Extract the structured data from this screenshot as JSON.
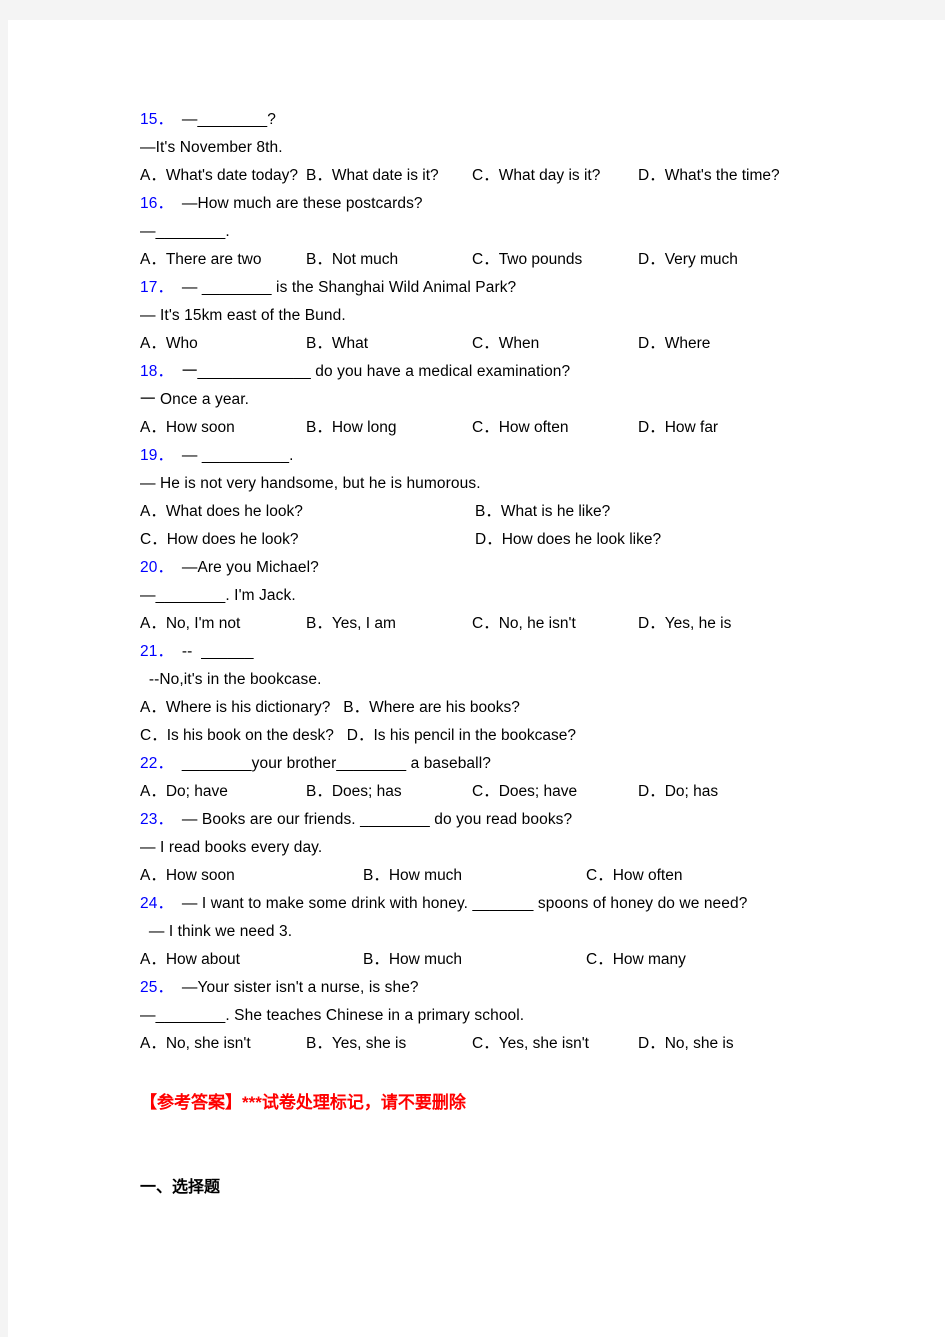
{
  "document": {
    "questions": [
      {
        "number": "15．",
        "lines": [
          "—________?",
          "—It's November 8th."
        ],
        "layout": "cols4",
        "options": [
          "A．What's date today?",
          "B．What date is it?",
          "C．What day is it?",
          "D．What's the time?"
        ]
      },
      {
        "number": "16．",
        "lines": [
          "—How much are these postcards?",
          "—________."
        ],
        "layout": "cols4",
        "options": [
          "A．There are two",
          "B．Not much",
          "C．Two pounds",
          "D．Very much"
        ]
      },
      {
        "number": "17．",
        "lines": [
          "— ________ is the Shanghai Wild Animal Park?",
          "— It's 15km east of the Bund."
        ],
        "layout": "cols4",
        "options": [
          "A．Who",
          "B．What",
          "C．When",
          "D．Where"
        ]
      },
      {
        "number": "18．",
        "lines": [
          "一_____________ do you have a medical examination?",
          "一 Once a year."
        ],
        "layout": "cols4",
        "options": [
          "A．How soon",
          "B．How long",
          "C．How often",
          "D．How far"
        ]
      },
      {
        "number": "19．",
        "lines": [
          "— __________.",
          "— He is not very handsome, but he is humorous."
        ],
        "layout": "cols2",
        "options": [
          "A．What does he look?",
          "B．What is he like?",
          "C．How does he look?",
          "D．How does he look like?"
        ]
      },
      {
        "number": "20．",
        "lines": [
          "—Are you Michael?",
          "—________. I'm Jack."
        ],
        "layout": "cols4",
        "options": [
          "A．No, I'm not",
          "B．Yes, I am",
          "C．No, he isn't",
          "D．Yes, he is"
        ]
      },
      {
        "number": "21．",
        "lines": [
          "--  ______",
          "  --No,it's in the bookcase."
        ],
        "layout": "colsflow",
        "options": [
          "A．Where is his dictionary?   ",
          "B．Where are his books?",
          "C．Is his book on the desk?   ",
          "D．Is his pencil in the bookcase?"
        ],
        "flow_breaks": [
          2
        ]
      },
      {
        "number": "22．",
        "lines": [
          "________your brother________ a baseball?"
        ],
        "layout": "cols4",
        "options": [
          "A．Do; have",
          "B．Does; has",
          "C．Does; have",
          "D．Do; has"
        ]
      },
      {
        "number": "23．",
        "lines": [
          "— Books are our friends. ________ do you read books?",
          "— I read books every day."
        ],
        "layout": "cols3",
        "options": [
          "A．How soon",
          "B．How much",
          "C．How often"
        ]
      },
      {
        "number": "24．",
        "lines": [
          "— I want to make some drink with honey. _______ spoons of honey do we need?",
          "  — I think we need 3."
        ],
        "layout": "cols3",
        "options": [
          "A．How about",
          "B．How much",
          "C．How many"
        ]
      },
      {
        "number": "25．",
        "lines": [
          "—Your sister isn't a nurse, is she?",
          "—________. She teaches Chinese in a primary school."
        ],
        "layout": "cols4",
        "options": [
          "A．No, she isn't",
          "B．Yes, she is",
          "C．Yes, she isn't",
          "D．No, she is"
        ]
      }
    ],
    "answer_marker": "【参考答案】***试卷处理标记，请不要删除",
    "section_heading": "一、选择题"
  }
}
